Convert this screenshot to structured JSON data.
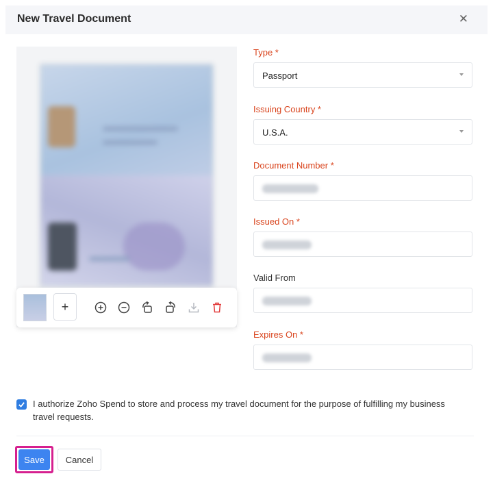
{
  "dialog": {
    "title": "New Travel Document",
    "close_icon": "close-icon"
  },
  "preview": {
    "toolbar": {
      "add_label": "+",
      "icons": [
        "zoom-in-icon",
        "zoom-out-icon",
        "rotate-left-icon",
        "rotate-right-icon",
        "download-icon",
        "delete-icon"
      ]
    }
  },
  "form": {
    "type": {
      "label": "Type *",
      "value": "Passport"
    },
    "issuing_country": {
      "label": "Issuing Country *",
      "value": "U.S.A."
    },
    "document_number": {
      "label": "Document Number *"
    },
    "issued_on": {
      "label": "Issued On *"
    },
    "valid_from": {
      "label": "Valid From"
    },
    "expires_on": {
      "label": "Expires On *"
    }
  },
  "consent": {
    "checked": true,
    "text": "I authorize Zoho Spend to store and process my travel document for the purpose of fulfilling my business travel requests."
  },
  "footer": {
    "save_label": "Save",
    "cancel_label": "Cancel"
  },
  "colors": {
    "required_label": "#d9441d",
    "primary": "#3d84f0",
    "highlight": "#d6208f"
  }
}
